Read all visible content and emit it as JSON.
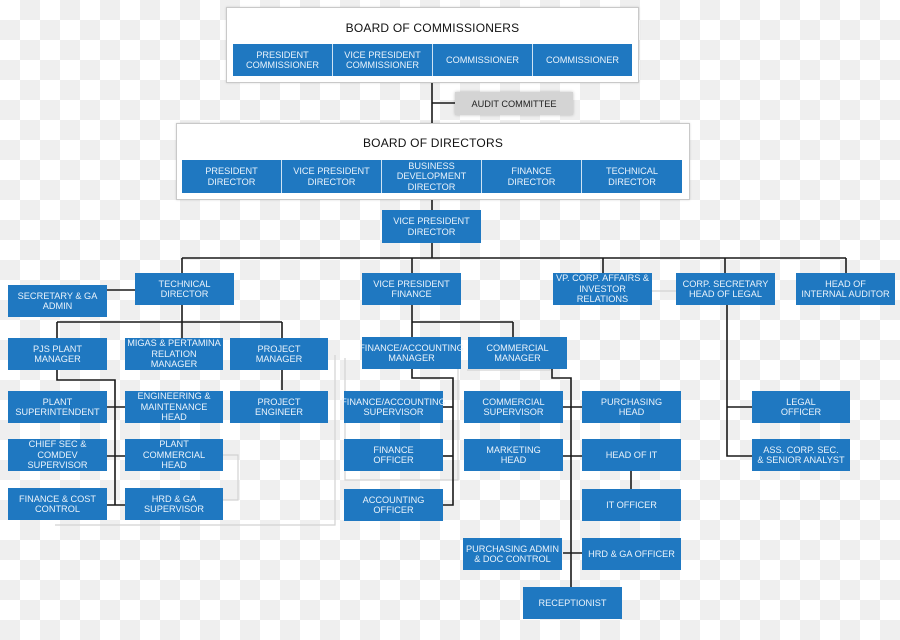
{
  "board_of_commissioners": {
    "title": "BOARD OF COMMISSIONERS",
    "members": [
      "PRESIDENT\nCOMMISSIONER",
      "VICE PRESIDENT\nCOMMISSIONER",
      "COMMISSIONER",
      "COMMISSIONER"
    ]
  },
  "audit_committee": "AUDIT COMMITTEE",
  "board_of_directors": {
    "title": "BOARD OF DIRECTORS",
    "members": [
      "PRESIDENT\nDIRECTOR",
      "VICE PRESIDENT\nDIRECTOR",
      "BUSINESS\nDEVELOPMENT\nDIRECTOR",
      "FINANCE\nDIRECTOR",
      "TECHNICAL\nDIRECTOR"
    ]
  },
  "vp_director": "VICE PRESIDENT\nDIRECTOR",
  "technical": {
    "director": "TECHNICAL\nDIRECTOR",
    "secretary": "SECRETARY & GA\nADMIN",
    "pjs_plant_manager": "PJS PLANT\nMANAGER",
    "migas_manager": "MIGAS & PERTAMINA\nRELATION MANAGER",
    "project_manager": "PROJECT\nMANAGER",
    "plant_superintendent": "PLANT\nSUPERINTENDENT",
    "chief_sec": "CHIEF SEC &\nCOMDEV SUPERVISOR",
    "finance_cost": "FINANCE & COST\nCONTROL",
    "eng_maint_head": "ENGINEERING &\nMAINTENANCE HEAD",
    "plant_commercial_head": "PLANT COMMERCIAL\nHEAD",
    "hrd_ga_supervisor": "HRD & GA\nSUPERVISOR",
    "project_engineer": "PROJECT\nENGINEER"
  },
  "finance": {
    "vp_finance": "VICE PRESIDENT\nFINANCE",
    "fa_manager": "FINANCE/ACCOUNTING\nMANAGER",
    "commercial_manager": "COMMERCIAL\nMANAGER",
    "fa_supervisor": "FINANCE/ACCOUNTING\nSUPERVISOR",
    "finance_officer": "FINANCE\nOFFICER",
    "accounting_officer": "ACCOUNTING\nOFFICER",
    "commercial_supervisor": "COMMERCIAL\nSUPERVISOR",
    "marketing_head": "MARKETING\nHEAD",
    "purchasing_admin": "PURCHASING ADMIN\n& DOC CONTROL",
    "purchasing_head": "PURCHASING\nHEAD",
    "head_of_it": "HEAD OF IT",
    "it_officer": "IT OFFICER",
    "hrd_ga_officer": "HRD & GA OFFICER",
    "receptionist": "RECEPTIONIST"
  },
  "corporate": {
    "vp_corp_affairs": "VP. CORP. AFFAIRS &\nINVESTOR RELATIONS",
    "corp_secretary": "CORP. SECRETARY\nHEAD OF LEGAL",
    "internal_auditor": "HEAD OF\nINTERNAL AUDITOR",
    "legal_officer": "LEGAL\nOFFICER",
    "ass_corp_sec": "ASS. CORP. SEC.\n& SENIOR ANALYST"
  }
}
